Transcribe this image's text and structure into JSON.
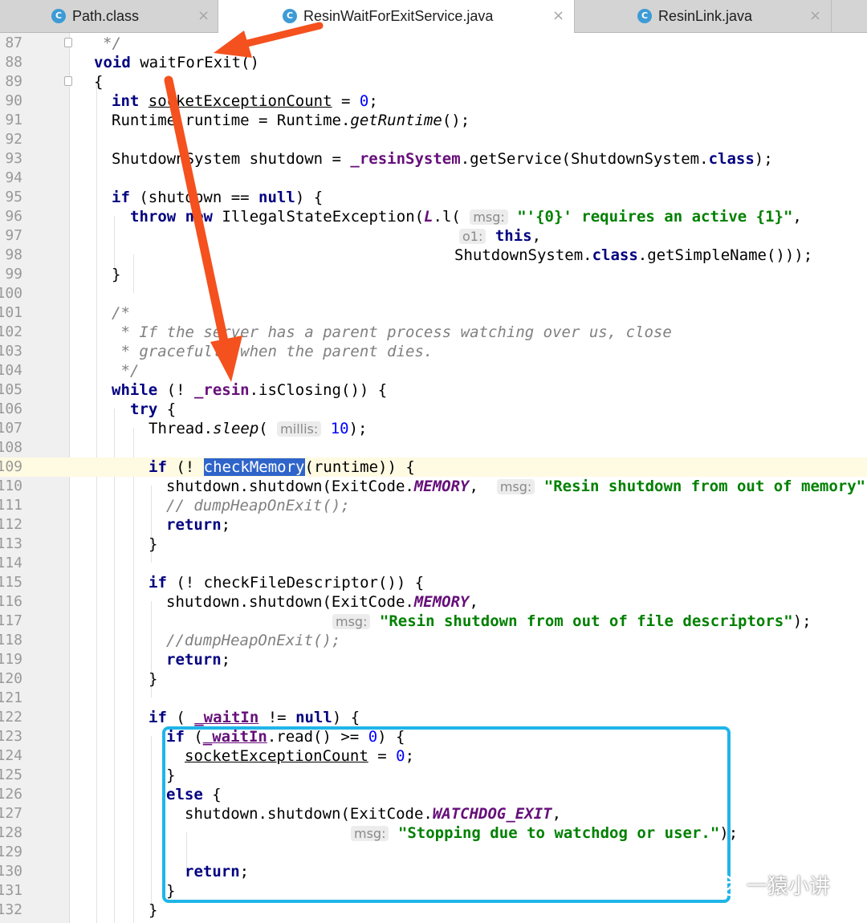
{
  "tabs": [
    {
      "label": "Path.class",
      "icon": "C",
      "active": false
    },
    {
      "label": "ResinWaitForExitService.java",
      "icon": "C",
      "active": true
    },
    {
      "label": "ResinLink.java",
      "icon": "C",
      "active": false
    }
  ],
  "close_glyph": "×",
  "line_numbers": [
    "87",
    "88",
    "89",
    "90",
    "91",
    "92",
    "93",
    "94",
    "95",
    "96",
    "97",
    "98",
    "99",
    "100",
    "101",
    "102",
    "103",
    "104",
    "105",
    "106",
    "107",
    "108",
    "109",
    "110",
    "111",
    "112",
    "113",
    "114",
    "115",
    "116",
    "117",
    "118",
    "119",
    "120",
    "121",
    "122",
    "123",
    "124",
    "125",
    "126",
    "127",
    "128",
    "129",
    "130",
    "131",
    "132"
  ],
  "code": {
    "l87": "*/",
    "l88_kw": "void",
    "l88_rest": " waitForExit()",
    "l89": "{",
    "l90_kw": "int",
    "l90_var": "socketExceptionCount",
    "l90_eq": " = ",
    "l90_num": "0",
    "l90_end": ";",
    "l91_a": "Runtime runtime = Runtime.",
    "l91_it": "getRuntime",
    "l91_b": "();",
    "l93_a": "ShutdownSystem shutdown = ",
    "l93_fld": "_resinSystem",
    "l93_b": ".getService(ShutdownSystem.",
    "l93_kw": "class",
    "l93_c": ");",
    "l95_kw": "if",
    "l95_a": " (shutdown == ",
    "l95_kw2": "null",
    "l95_b": ") {",
    "l96_kw": "throw",
    "l96_kw2": "new",
    "l96_a": " IllegalStateException(",
    "l96_fld": "L",
    "l96_b": ".l( ",
    "l96_hint": "msg:",
    "l96_str": "\"'{0}' requires an active {1}\"",
    "l96_c": ",",
    "l97_hint": "o1:",
    "l97_kw": "this",
    "l97_a": ",",
    "l98_a": "ShutdownSystem.",
    "l98_kw": "class",
    "l98_b": ".getSimpleName()));",
    "l99": "}",
    "l101": "/*",
    "l102": " * If the server has a parent process watching over us, close",
    "l103": " * gracefully when the parent dies.",
    "l104": " */",
    "l105_kw": "while",
    "l105_a": " (! ",
    "l105_fld": "_resin",
    "l105_b": ".isClosing()) {",
    "l106_kw": "try",
    "l106_a": " {",
    "l107_a": "Thread.",
    "l107_it": "sleep",
    "l107_b": "( ",
    "l107_hint": "millis:",
    "l107_num": "10",
    "l107_c": ");",
    "l109_kw": "if",
    "l109_a": " (! ",
    "l109_sel": "checkMemory",
    "l109_b": "(runtime)) {",
    "l110_a": "shutdown.shutdown(ExitCode.",
    "l110_cst": "MEMORY",
    "l110_b": ",  ",
    "l110_hint": "msg:",
    "l110_str": "\"Resin shutdown from out of memory\"",
    "l110_c": ");",
    "l111": "// dumpHeapOnExit();",
    "l112_kw": "return",
    "l112_a": ";",
    "l113": "}",
    "l115_kw": "if",
    "l115_a": " (! checkFileDescriptor()) {",
    "l116_a": "shutdown.shutdown(ExitCode.",
    "l116_cst": "MEMORY",
    "l116_b": ",",
    "l117_hint": "msg:",
    "l117_str": "\"Resin shutdown from out of file descriptors\"",
    "l117_a": ");",
    "l118": "//dumpHeapOnExit();",
    "l119_kw": "return",
    "l119_a": ";",
    "l120": "}",
    "l122_kw": "if",
    "l122_a": " ( ",
    "l122_fld": "_waitIn",
    "l122_b": " != ",
    "l122_kw2": "null",
    "l122_c": ") {",
    "l123_kw": "if",
    "l123_a": " (",
    "l123_fld": "_waitIn",
    "l123_b": ".read() >= ",
    "l123_num": "0",
    "l123_c": ") {",
    "l124_var": "socketExceptionCount",
    "l124_a": " = ",
    "l124_num": "0",
    "l124_b": ";",
    "l125": "}",
    "l126_kw": "else",
    "l126_a": " {",
    "l127_a": "shutdown.shutdown(ExitCode.",
    "l127_cst": "WATCHDOG_EXIT",
    "l127_b": ",",
    "l128_hint": "msg:",
    "l128_str": "\"Stopping due to watchdog or user.\"",
    "l128_a": ");",
    "l130_kw": "return",
    "l130_a": ";",
    "l131": "}",
    "l132": "}"
  },
  "colors": {
    "arrow": "#f4511e",
    "highlight_box": "#1fb5e8",
    "keyword": "#000080",
    "string": "#008000",
    "field": "#660e7a"
  },
  "watermark": {
    "text": "一猿小讲",
    "icon": "wechat-logo-icon"
  }
}
